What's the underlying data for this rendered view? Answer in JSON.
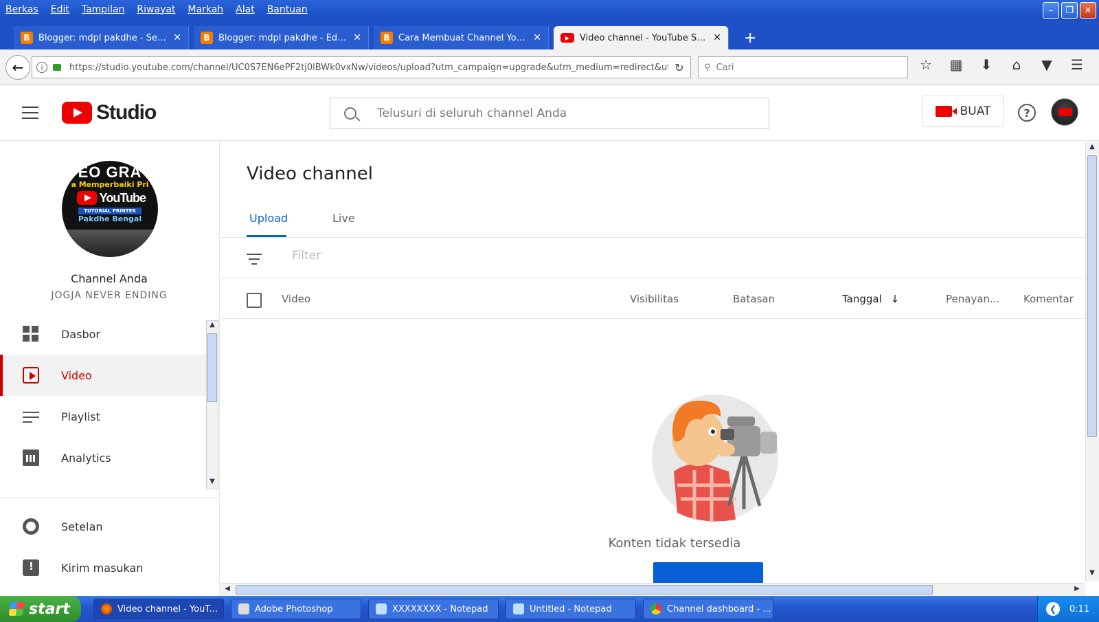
{
  "window": {
    "menu": [
      "Berkas",
      "Edit",
      "Tampilan",
      "Riwayat",
      "Markah",
      "Alat",
      "Bantuan"
    ]
  },
  "browser": {
    "tabs": [
      {
        "title": "Blogger: mdpl pakdhe - Semu...",
        "icon": "blogger-icon"
      },
      {
        "title": "Blogger: mdpl pakdhe - Edit e...",
        "icon": "blogger-icon"
      },
      {
        "title": "Cara Membuat Channel Youtu...",
        "icon": "blogger-icon"
      },
      {
        "title": "Video channel - YouTube Studio",
        "icon": "youtube-icon",
        "active": true
      }
    ],
    "url": "https://studio.youtube.com/channel/UC0S7EN6ePF2tj0lBWk0vxNw/videos/upload?utm_campaign=upgrade&utm_medium=redirect&utm_s",
    "search_placeholder": "Cari"
  },
  "studio": {
    "logo_text": "Studio",
    "search_placeholder": "Telusuri di seluruh channel Anda",
    "create_label": "BUAT",
    "help_symbol": "?",
    "accent_color": "#065fd4",
    "brand_red": "#ff0000"
  },
  "channel": {
    "name": "Channel Anda",
    "subtitle": "JOGJA NEVER ENDING",
    "avatar_text": [
      "EO GRA",
      "a Memperbaiki Pri",
      "YouTube",
      "TUTORIAL PRINTER",
      "Pakdhe Bengal"
    ]
  },
  "sidebar": {
    "items": [
      {
        "label": "Dasbor",
        "icon": "dashboard-icon"
      },
      {
        "label": "Video",
        "icon": "video-icon",
        "active": true
      },
      {
        "label": "Playlist",
        "icon": "playlist-icon"
      },
      {
        "label": "Analytics",
        "icon": "analytics-icon"
      }
    ],
    "bottom_items": [
      {
        "label": "Setelan",
        "icon": "gear-icon"
      },
      {
        "label": "Kirim masukan",
        "icon": "feedback-icon"
      }
    ]
  },
  "main": {
    "title": "Video channel",
    "tabs": [
      {
        "label": "Upload",
        "active": true
      },
      {
        "label": "Live"
      }
    ],
    "filter_placeholder": "Filter",
    "columns": [
      "Video",
      "Visibilitas",
      "Batasan",
      "Tanggal",
      "Penayan...",
      "Komentar"
    ],
    "sort_column": "Tanggal",
    "empty_text": "Konten tidak tersedia"
  },
  "taskbar": {
    "start_label": "start",
    "tasks": [
      {
        "label": "Video channel - YouT...",
        "icon": "firefox-icon"
      },
      {
        "label": "Adobe Photoshop",
        "icon": "photoshop-icon"
      },
      {
        "label": "XXXXXXXX - Notepad",
        "icon": "notepad-icon"
      },
      {
        "label": "Untitled - Notepad",
        "icon": "notepad-icon"
      },
      {
        "label": "Channel dashboard - ...",
        "icon": "chrome-icon"
      }
    ],
    "clock": "0:11"
  }
}
